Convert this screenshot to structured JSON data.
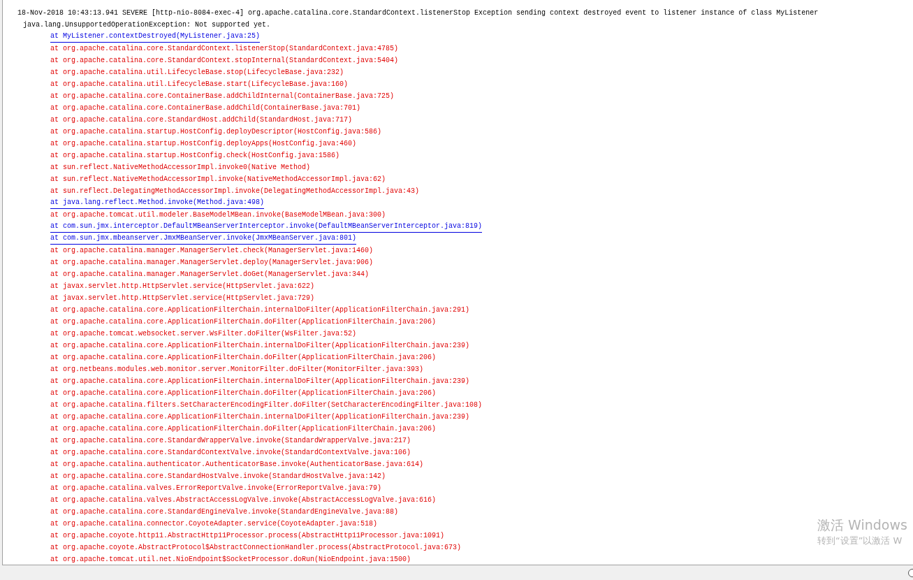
{
  "output": {
    "lines": [
      {
        "kind": "header",
        "text": "18-Nov-2018 10:43:13.941 SEVERE [http-nio-8084-exec-4] org.apache.catalina.core.StandardContext.listenerStop Exception sending context destroyed event to listener instance of class MyListener"
      },
      {
        "kind": "exception",
        "text": "java.lang.UnsupportedOperationException: Not supported yet."
      },
      {
        "kind": "link",
        "text": "at MyListener.contextDestroyed(MyListener.java:25)"
      },
      {
        "kind": "frame",
        "text": "at org.apache.catalina.core.StandardContext.listenerStop(StandardContext.java:4785)"
      },
      {
        "kind": "frame",
        "text": "at org.apache.catalina.core.StandardContext.stopInternal(StandardContext.java:5404)"
      },
      {
        "kind": "frame",
        "text": "at org.apache.catalina.util.LifecycleBase.stop(LifecycleBase.java:232)"
      },
      {
        "kind": "frame",
        "text": "at org.apache.catalina.util.LifecycleBase.start(LifecycleBase.java:160)"
      },
      {
        "kind": "frame",
        "text": "at org.apache.catalina.core.ContainerBase.addChildInternal(ContainerBase.java:725)"
      },
      {
        "kind": "frame",
        "text": "at org.apache.catalina.core.ContainerBase.addChild(ContainerBase.java:701)"
      },
      {
        "kind": "frame",
        "text": "at org.apache.catalina.core.StandardHost.addChild(StandardHost.java:717)"
      },
      {
        "kind": "frame",
        "text": "at org.apache.catalina.startup.HostConfig.deployDescriptor(HostConfig.java:586)"
      },
      {
        "kind": "frame",
        "text": "at org.apache.catalina.startup.HostConfig.deployApps(HostConfig.java:460)"
      },
      {
        "kind": "frame",
        "text": "at org.apache.catalina.startup.HostConfig.check(HostConfig.java:1586)"
      },
      {
        "kind": "frame",
        "text": "at sun.reflect.NativeMethodAccessorImpl.invoke0(Native Method)"
      },
      {
        "kind": "frame",
        "text": "at sun.reflect.NativeMethodAccessorImpl.invoke(NativeMethodAccessorImpl.java:62)"
      },
      {
        "kind": "frame",
        "text": "at sun.reflect.DelegatingMethodAccessorImpl.invoke(DelegatingMethodAccessorImpl.java:43)"
      },
      {
        "kind": "link",
        "text": "at java.lang.reflect.Method.invoke(Method.java:498)"
      },
      {
        "kind": "frame",
        "text": "at org.apache.tomcat.util.modeler.BaseModelMBean.invoke(BaseModelMBean.java:300)"
      },
      {
        "kind": "link",
        "text": "at com.sun.jmx.interceptor.DefaultMBeanServerInterceptor.invoke(DefaultMBeanServerInterceptor.java:819)"
      },
      {
        "kind": "link",
        "text": "at com.sun.jmx.mbeanserver.JmxMBeanServer.invoke(JmxMBeanServer.java:801)"
      },
      {
        "kind": "frame",
        "text": "at org.apache.catalina.manager.ManagerServlet.check(ManagerServlet.java:1460)"
      },
      {
        "kind": "frame",
        "text": "at org.apache.catalina.manager.ManagerServlet.deploy(ManagerServlet.java:906)"
      },
      {
        "kind": "frame",
        "text": "at org.apache.catalina.manager.ManagerServlet.doGet(ManagerServlet.java:344)"
      },
      {
        "kind": "frame",
        "text": "at javax.servlet.http.HttpServlet.service(HttpServlet.java:622)"
      },
      {
        "kind": "frame",
        "text": "at javax.servlet.http.HttpServlet.service(HttpServlet.java:729)"
      },
      {
        "kind": "frame",
        "text": "at org.apache.catalina.core.ApplicationFilterChain.internalDoFilter(ApplicationFilterChain.java:291)"
      },
      {
        "kind": "frame",
        "text": "at org.apache.catalina.core.ApplicationFilterChain.doFilter(ApplicationFilterChain.java:206)"
      },
      {
        "kind": "frame",
        "text": "at org.apache.tomcat.websocket.server.WsFilter.doFilter(WsFilter.java:52)"
      },
      {
        "kind": "frame",
        "text": "at org.apache.catalina.core.ApplicationFilterChain.internalDoFilter(ApplicationFilterChain.java:239)"
      },
      {
        "kind": "frame",
        "text": "at org.apache.catalina.core.ApplicationFilterChain.doFilter(ApplicationFilterChain.java:206)"
      },
      {
        "kind": "frame",
        "text": "at org.netbeans.modules.web.monitor.server.MonitorFilter.doFilter(MonitorFilter.java:393)"
      },
      {
        "kind": "frame",
        "text": "at org.apache.catalina.core.ApplicationFilterChain.internalDoFilter(ApplicationFilterChain.java:239)"
      },
      {
        "kind": "frame",
        "text": "at org.apache.catalina.core.ApplicationFilterChain.doFilter(ApplicationFilterChain.java:206)"
      },
      {
        "kind": "frame",
        "text": "at org.apache.catalina.filters.SetCharacterEncodingFilter.doFilter(SetCharacterEncodingFilter.java:108)"
      },
      {
        "kind": "frame",
        "text": "at org.apache.catalina.core.ApplicationFilterChain.internalDoFilter(ApplicationFilterChain.java:239)"
      },
      {
        "kind": "frame",
        "text": "at org.apache.catalina.core.ApplicationFilterChain.doFilter(ApplicationFilterChain.java:206)"
      },
      {
        "kind": "frame",
        "text": "at org.apache.catalina.core.StandardWrapperValve.invoke(StandardWrapperValve.java:217)"
      },
      {
        "kind": "frame",
        "text": "at org.apache.catalina.core.StandardContextValve.invoke(StandardContextValve.java:106)"
      },
      {
        "kind": "frame",
        "text": "at org.apache.catalina.authenticator.AuthenticatorBase.invoke(AuthenticatorBase.java:614)"
      },
      {
        "kind": "frame",
        "text": "at org.apache.catalina.core.StandardHostValve.invoke(StandardHostValve.java:142)"
      },
      {
        "kind": "frame",
        "text": "at org.apache.catalina.valves.ErrorReportValve.invoke(ErrorReportValve.java:79)"
      },
      {
        "kind": "frame",
        "text": "at org.apache.catalina.valves.AbstractAccessLogValve.invoke(AbstractAccessLogValve.java:616)"
      },
      {
        "kind": "frame",
        "text": "at org.apache.catalina.core.StandardEngineValve.invoke(StandardEngineValve.java:88)"
      },
      {
        "kind": "frame",
        "text": "at org.apache.catalina.connector.CoyoteAdapter.service(CoyoteAdapter.java:518)"
      },
      {
        "kind": "frame",
        "text": "at org.apache.coyote.http11.AbstractHttp11Processor.process(AbstractHttp11Processor.java:1091)"
      },
      {
        "kind": "frame",
        "text": "at org.apache.coyote.AbstractProtocol$AbstractConnectionHandler.process(AbstractProtocol.java:673)"
      },
      {
        "kind": "frame",
        "text": "at org.apache.tomcat.util.net.NioEndpoint$SocketProcessor.doRun(NioEndpoint.java:1500)"
      }
    ]
  },
  "activation_notice": {
    "title": "激活 Windows",
    "subtitle": "转到“设置”以激活 W"
  }
}
